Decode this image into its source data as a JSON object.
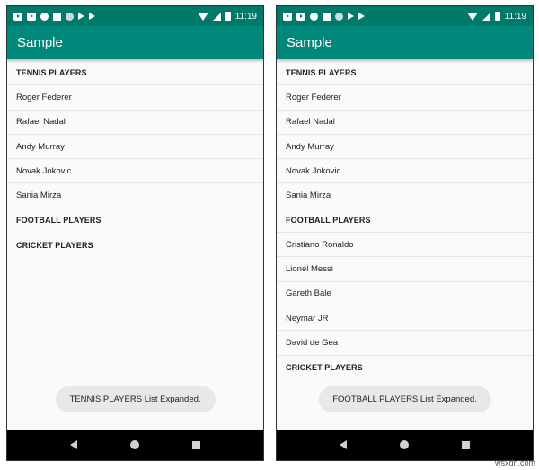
{
  "screens": [
    {
      "time": "11:19",
      "app_title": "Sample",
      "groups": [
        {
          "title": "TENNIS PLAYERS",
          "expanded": true,
          "items": [
            "Roger Federer",
            "Rafael Nadal",
            "Andy Murray",
            "Novak Jokovic",
            "Sania Mirza"
          ]
        },
        {
          "title": "FOOTBALL PLAYERS",
          "expanded": false,
          "items": []
        },
        {
          "title": "CRICKET PLAYERS",
          "expanded": false,
          "items": []
        }
      ],
      "toast": "TENNIS PLAYERS List Expanded."
    },
    {
      "time": "11:19",
      "app_title": "Sample",
      "groups": [
        {
          "title": "TENNIS PLAYERS",
          "expanded": true,
          "items": [
            "Roger Federer",
            "Rafael Nadal",
            "Andy Murray",
            "Novak Jokovic",
            "Sania Mirza"
          ]
        },
        {
          "title": "FOOTBALL PLAYERS",
          "expanded": true,
          "items": [
            "Cristiano Ronaldo",
            "Lionel Messi",
            "Gareth Bale",
            "Neymar JR",
            "David de Gea"
          ]
        },
        {
          "title": "CRICKET PLAYERS",
          "expanded": false,
          "items": []
        }
      ],
      "toast": "FOOTBALL PLAYERS List Expanded."
    }
  ],
  "watermark": "wsxdn.com",
  "colors": {
    "status_bar": "#00796b",
    "app_bar": "#00897b",
    "nav_bar": "#000000"
  }
}
